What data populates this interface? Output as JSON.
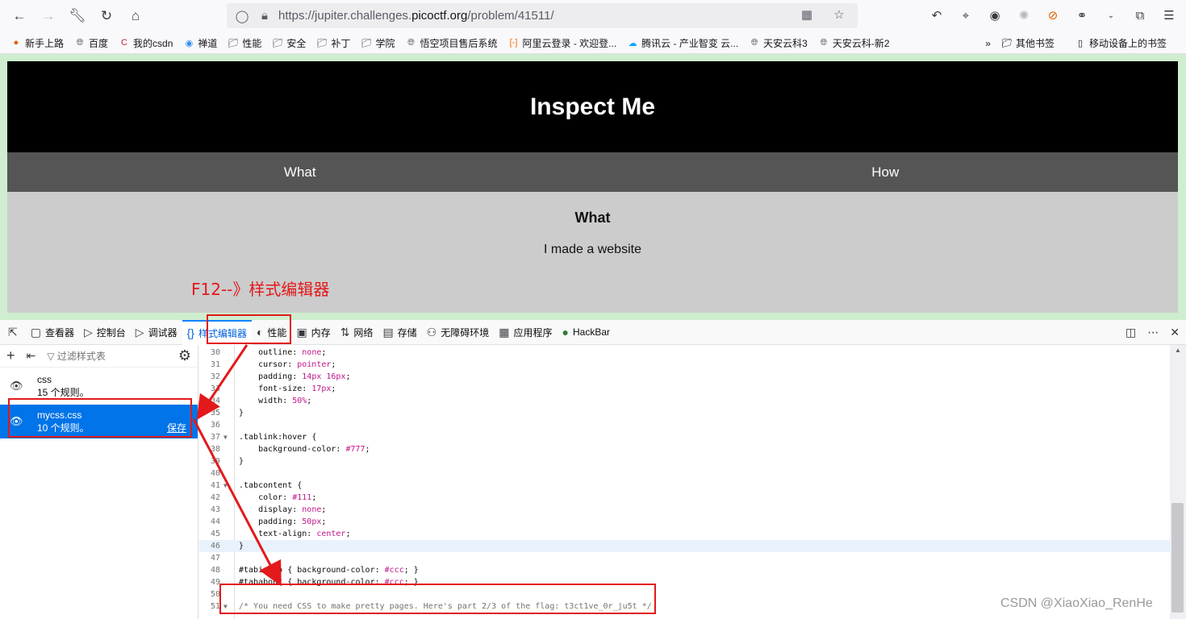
{
  "browser": {
    "url_prefix": "https://jupiter.challenges.",
    "url_host": "picoctf.org",
    "url_path": "/problem/41511/"
  },
  "bookmarks": [
    {
      "label": "新手上路",
      "icon": "firefox-icon",
      "color": "#e66000"
    },
    {
      "label": "百度",
      "icon": "globe-icon",
      "color": "#5b5b66"
    },
    {
      "label": "我的csdn",
      "icon": "csdn-icon",
      "color": "#c32136"
    },
    {
      "label": "禅道",
      "icon": "zentao-icon",
      "color": "#2d8cf0"
    },
    {
      "label": "性能",
      "icon": "folder-icon",
      "color": "#5b5b66"
    },
    {
      "label": "安全",
      "icon": "folder-icon",
      "color": "#5b5b66"
    },
    {
      "label": "补丁",
      "icon": "folder-icon",
      "color": "#5b5b66"
    },
    {
      "label": "学院",
      "icon": "folder-icon",
      "color": "#5b5b66"
    },
    {
      "label": "悟空项目售后系统",
      "icon": "globe-icon",
      "color": "#5b5b66"
    },
    {
      "label": "阿里云登录 - 欢迎登...",
      "icon": "aliyun-icon",
      "color": "#ff6a00"
    },
    {
      "label": "腾讯云 - 产业智变 云...",
      "icon": "tencent-cloud-icon",
      "color": "#00a3ff"
    },
    {
      "label": "天安云科3",
      "icon": "globe-icon",
      "color": "#5b5b66"
    },
    {
      "label": "天安云科-新2",
      "icon": "globe-icon",
      "color": "#5b5b66"
    }
  ],
  "bookmarks_right": {
    "other": "其他书签",
    "mobile": "移动设备上的书签"
  },
  "page": {
    "header_title": "Inspect Me",
    "tab_what": "What",
    "tab_how": "How",
    "content_heading": "What",
    "content_text": "I made a website"
  },
  "annotation": {
    "label": "F12--》样式编辑器",
    "color": "#e3191b"
  },
  "devtools": {
    "tabs": [
      {
        "label": "查看器",
        "icon": "inspector-icon"
      },
      {
        "label": "控制台",
        "icon": "console-icon"
      },
      {
        "label": "调试器",
        "icon": "debugger-icon"
      },
      {
        "label": "样式编辑器",
        "icon": "style-editor-icon",
        "active": true
      },
      {
        "label": "性能",
        "icon": "performance-icon"
      },
      {
        "label": "内存",
        "icon": "memory-icon"
      },
      {
        "label": "网络",
        "icon": "network-icon"
      },
      {
        "label": "存储",
        "icon": "storage-icon"
      },
      {
        "label": "无障碍环境",
        "icon": "accessibility-icon"
      },
      {
        "label": "应用程序",
        "icon": "application-icon"
      },
      {
        "label": "HackBar",
        "icon": "hackbar-icon"
      }
    ],
    "filter_placeholder": "过滤样式表",
    "stylesheets": [
      {
        "name": "css",
        "rules": "15 个规则。",
        "selected": false
      },
      {
        "name": "mycss.css",
        "rules": "10 个规则。",
        "selected": true,
        "save": "保存"
      }
    ]
  },
  "code_lines": [
    {
      "n": "30",
      "parts": [
        [
          "prop",
          "    outline: "
        ],
        [
          "val",
          "none"
        ],
        [
          "punc",
          ";"
        ]
      ]
    },
    {
      "n": "31",
      "parts": [
        [
          "prop",
          "    cursor: "
        ],
        [
          "val",
          "pointer"
        ],
        [
          "punc",
          ";"
        ]
      ]
    },
    {
      "n": "32",
      "parts": [
        [
          "prop",
          "    padding: "
        ],
        [
          "val",
          "14px 16px"
        ],
        [
          "punc",
          ";"
        ]
      ]
    },
    {
      "n": "33",
      "parts": [
        [
          "prop",
          "    font-size: "
        ],
        [
          "val",
          "17px"
        ],
        [
          "punc",
          ";"
        ]
      ]
    },
    {
      "n": "34",
      "parts": [
        [
          "prop",
          "    width: "
        ],
        [
          "val",
          "50%"
        ],
        [
          "punc",
          ";"
        ]
      ]
    },
    {
      "n": "35",
      "parts": [
        [
          "punc",
          "}"
        ]
      ]
    },
    {
      "n": "36",
      "parts": []
    },
    {
      "n": "37",
      "fold": true,
      "parts": [
        [
          "sel",
          ".tablink:hover "
        ],
        [
          "punc",
          "{"
        ]
      ]
    },
    {
      "n": "38",
      "parts": [
        [
          "prop",
          "    background-color: "
        ],
        [
          "val",
          "#777"
        ],
        [
          "punc",
          ";"
        ]
      ]
    },
    {
      "n": "39",
      "parts": [
        [
          "punc",
          "}"
        ]
      ]
    },
    {
      "n": "40",
      "parts": []
    },
    {
      "n": "41",
      "fold": true,
      "parts": [
        [
          "sel",
          ".tabcontent "
        ],
        [
          "punc",
          "{"
        ]
      ]
    },
    {
      "n": "42",
      "parts": [
        [
          "prop",
          "    color: "
        ],
        [
          "val",
          "#111"
        ],
        [
          "punc",
          ";"
        ]
      ]
    },
    {
      "n": "43",
      "parts": [
        [
          "prop",
          "    display: "
        ],
        [
          "val",
          "none"
        ],
        [
          "punc",
          ";"
        ]
      ]
    },
    {
      "n": "44",
      "parts": [
        [
          "prop",
          "    padding: "
        ],
        [
          "val",
          "50px"
        ],
        [
          "punc",
          ";"
        ]
      ]
    },
    {
      "n": "45",
      "parts": [
        [
          "prop",
          "    text-align: "
        ],
        [
          "val",
          "center"
        ],
        [
          "punc",
          ";"
        ]
      ]
    },
    {
      "n": "46",
      "cur": true,
      "parts": [
        [
          "punc",
          "}"
        ]
      ]
    },
    {
      "n": "47",
      "parts": []
    },
    {
      "n": "48",
      "parts": [
        [
          "sel",
          "#tabintro "
        ],
        [
          "punc",
          "{ "
        ],
        [
          "prop",
          "background-color: "
        ],
        [
          "val",
          "#ccc"
        ],
        [
          "punc",
          "; }"
        ]
      ]
    },
    {
      "n": "49",
      "parts": [
        [
          "sel",
          "#tababout "
        ],
        [
          "punc",
          "{ "
        ],
        [
          "prop",
          "background-color: "
        ],
        [
          "val",
          "#ccc"
        ],
        [
          "punc",
          "; }"
        ]
      ]
    },
    {
      "n": "50",
      "parts": []
    },
    {
      "n": "51",
      "fold": true,
      "parts": [
        [
          "comment",
          "/* You need CSS to make pretty pages. Here's part 2/3 of the flag: t3ct1ve_0r_ju5t */"
        ]
      ]
    }
  ],
  "watermark": "CSDN @XiaoXiao_RenHe"
}
